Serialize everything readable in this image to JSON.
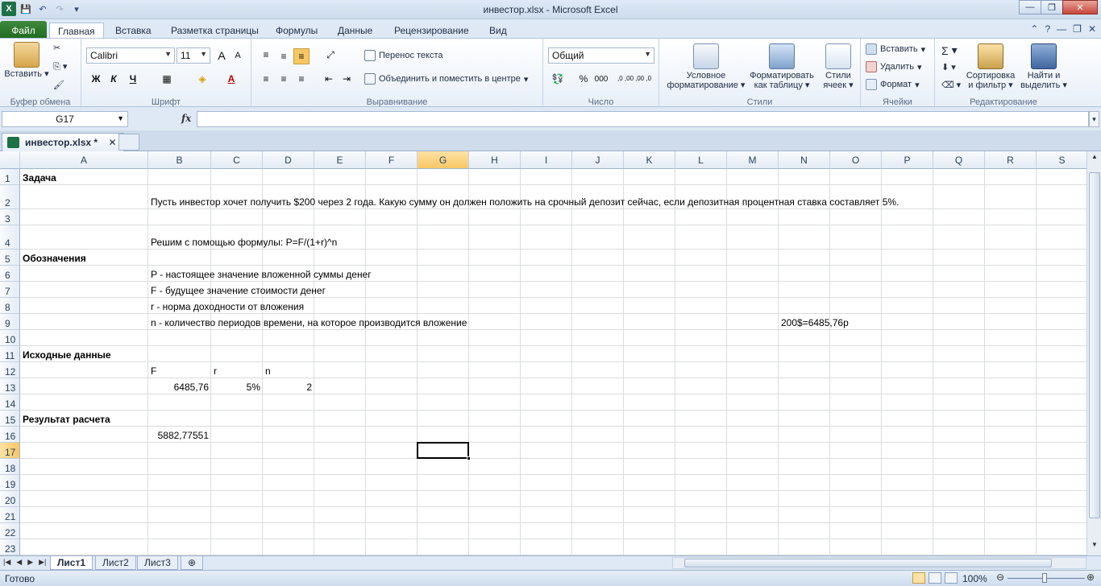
{
  "window": {
    "title": "инвестор.xlsx  -  Microsoft Excel"
  },
  "ribbon_tabs": [
    "Файл",
    "Главная",
    "Вставка",
    "Разметка страницы",
    "Формулы",
    "Данные",
    "Рецензирование",
    "Вид"
  ],
  "ribbon": {
    "clipboard": {
      "paste": "Вставить",
      "label": "Буфер обмена"
    },
    "font": {
      "name": "Calibri",
      "size": "11",
      "bold": "Ж",
      "italic": "К",
      "underline": "Ч",
      "grow": "A",
      "shrink": "A",
      "color_letter": "A",
      "label": "Шрифт"
    },
    "alignment": {
      "wrap": "Перенос текста",
      "merge": "Объединить и поместить в центре",
      "label": "Выравнивание"
    },
    "number": {
      "format": "Общий",
      "percent": "%",
      "thousands": "000",
      "inc": ",0 ,00",
      "dec": ",00 ,0",
      "label": "Число"
    },
    "styles": {
      "conditional": "Условное форматирование",
      "as_table": "Форматировать как таблицу",
      "cell_styles": "Стили ячеек",
      "label": "Стили"
    },
    "cells": {
      "insert": "Вставить",
      "delete": "Удалить",
      "format": "Формат",
      "label": "Ячейки"
    },
    "editing": {
      "sum": "Σ",
      "sort": "Сортировка и фильтр",
      "find": "Найти и выделить",
      "label": "Редактирование"
    }
  },
  "formula_bar": {
    "name_box": "G17",
    "fx": "fx",
    "formula": ""
  },
  "document_tab": {
    "name": "инвестор.xlsx *",
    "close": "✕"
  },
  "columns": [
    "A",
    "B",
    "C",
    "D",
    "E",
    "F",
    "G",
    "H",
    "I",
    "J",
    "K",
    "L",
    "M",
    "N",
    "O",
    "P",
    "Q",
    "R",
    "S"
  ],
  "rows": [
    "1",
    "2",
    "3",
    "4",
    "5",
    "6",
    "7",
    "8",
    "9",
    "10",
    "11",
    "12",
    "13",
    "14",
    "15",
    "16",
    "17",
    "18",
    "19",
    "20",
    "21",
    "22",
    "23"
  ],
  "cells": {
    "A1": "Задача",
    "B2": "Пусть инвестор хочет получить $200 через 2 года. Какую сумму он должен положить на срочный депозит сейчас, если депозитная процентная ставка составляет 5%.",
    "B4": "Решим с помощью формулы: P=F/(1+r)^n",
    "A5": "Обозначения",
    "B6": "P - настоящее значение вложенной суммы денег",
    "B7": "F - будущее значение стоимости денег",
    "B8": "r - норма доходности от вложения",
    "B9": "n - количество периодов времени, на которое производится вложение",
    "N9": "200$=6485,76р",
    "A11": "Исходные данные",
    "B12": "F",
    "C12": "r",
    "D12": "n",
    "B13": "6485,76",
    "C13": "5%",
    "D13": "2",
    "A15": "Результат расчета",
    "B16": "5882,77551"
  },
  "selected_cell": "G17",
  "sheet_tabs": [
    "Лист1",
    "Лист2",
    "Лист3"
  ],
  "status": {
    "ready": "Готово",
    "zoom": "100%"
  },
  "colors": {
    "file_tab": "#1f6b1f",
    "selection_header": "#f8c764",
    "excel_green": "#1e7145"
  }
}
